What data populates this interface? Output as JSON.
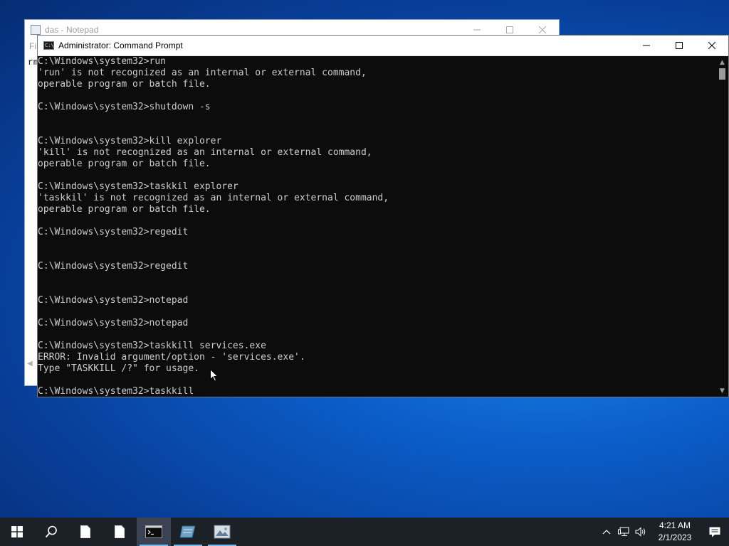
{
  "notepad": {
    "title": "das - Notepad",
    "menu_first": "Fi",
    "content_fragment": "rm"
  },
  "cmd": {
    "title": "Administrator:  Command Prompt",
    "icon_text": "C:\\",
    "lines": [
      "C:\\Windows\\system32>run",
      "'run' is not recognized as an internal or external command,",
      "operable program or batch file.",
      "",
      "C:\\Windows\\system32>shutdown -s",
      "",
      "",
      "C:\\Windows\\system32>kill explorer",
      "'kill' is not recognized as an internal or external command,",
      "operable program or batch file.",
      "",
      "C:\\Windows\\system32>taskkil explorer",
      "'taskkil' is not recognized as an internal or external command,",
      "operable program or batch file.",
      "",
      "C:\\Windows\\system32>regedit",
      "",
      "",
      "C:\\Windows\\system32>regedit",
      "",
      "",
      "C:\\Windows\\system32>notepad",
      "",
      "C:\\Windows\\system32>notepad",
      "",
      "C:\\Windows\\system32>taskkill services.exe",
      "ERROR: Invalid argument/option - 'services.exe'.",
      "Type \"TASKKILL /?\" for usage.",
      "",
      "C:\\Windows\\system32>taskkill"
    ]
  },
  "taskbar": {
    "items": [
      "start-icon",
      "search-icon",
      "file-icon",
      "file-icon",
      "command-prompt-icon",
      "notepad-icon",
      "image-app-icon"
    ],
    "active_index": 4
  },
  "tray": {
    "time": "4:21 AM",
    "date": "2/1/2023"
  },
  "colors": {
    "desktop": "#0b5dc8",
    "console_bg": "#0c0c0c",
    "console_text": "#cccccc",
    "taskbar": "#1c2027",
    "active_indicator": "#76b9ed"
  }
}
